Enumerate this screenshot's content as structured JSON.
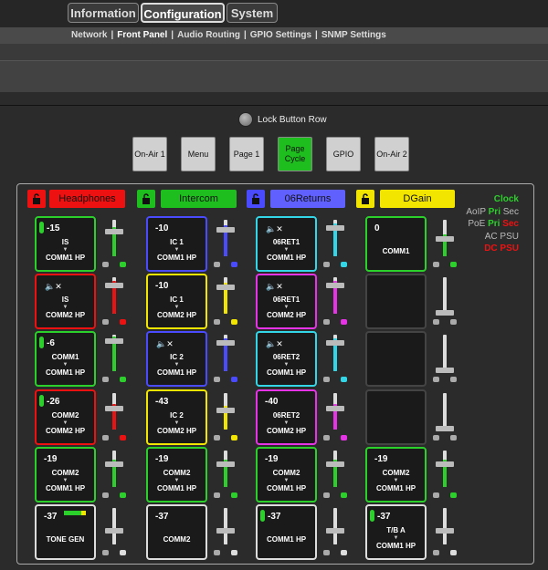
{
  "tabs": [
    {
      "label": "Information",
      "active": false
    },
    {
      "label": "Configuration",
      "active": true
    },
    {
      "label": "System",
      "active": false
    }
  ],
  "subnav": [
    {
      "label": "Network",
      "active": false
    },
    {
      "label": "Front Panel",
      "active": true
    },
    {
      "label": "Audio Routing",
      "active": false
    },
    {
      "label": "GPIO Settings",
      "active": false
    },
    {
      "label": "SNMP Settings",
      "active": false
    }
  ],
  "lock_row_label": "Lock Button Row",
  "page_buttons": [
    {
      "label": "On-Air 1",
      "active": false
    },
    {
      "label": "Menu",
      "active": false
    },
    {
      "label": "Page 1",
      "active": false
    },
    {
      "label": "Page Cycle",
      "active": true
    },
    {
      "label": "GPIO",
      "active": false
    },
    {
      "label": "On-Air 2",
      "active": false
    }
  ],
  "groups": [
    {
      "name": "Headphones",
      "color": "#ee1111",
      "name_color": "#ee1111"
    },
    {
      "name": "Intercom",
      "color": "#1dbe1d",
      "name_color": "#1dbe1d"
    },
    {
      "name": "06Returns",
      "color": "#4a4aff",
      "name_color": "#6060ff"
    },
    {
      "name": "DGain",
      "color": "#f2e600",
      "name_color": "#f2e600"
    }
  ],
  "status": {
    "clock": {
      "label": "Clock",
      "color": "#2bd02b"
    },
    "aoip": {
      "label": "AoIP",
      "pri": "Pri",
      "sec": "Sec",
      "pri_color": "#2bd02b",
      "sec_color": "#bbbbbb"
    },
    "poe": {
      "label": "PoE",
      "pri": "Pri",
      "sec": "Sec",
      "pri_color": "#2bd02b",
      "sec_color": "#ee1111"
    },
    "ac": {
      "label": "AC PSU",
      "color": "#bbbbbb"
    },
    "dc": {
      "label": "DC PSU",
      "color": "#ee1111"
    }
  },
  "columns": [
    [
      {
        "level": "-15",
        "src": "IS",
        "dst": "COMM1 HP",
        "border": "#2bd02b",
        "pill": true,
        "fader": "#2bd02b",
        "fill": 0.8
      },
      {
        "mute": true,
        "src": "IS",
        "dst": "COMM2 HP",
        "border": "#ee1111",
        "fader": "#ee1111",
        "fill": 0.9
      },
      {
        "level": "-6",
        "src": "COMM1",
        "dst": "COMM1 HP",
        "border": "#2bd02b",
        "pill": true,
        "fader": "#2bd02b",
        "fill": 0.95
      },
      {
        "level": "-26",
        "src": "COMM2",
        "dst": "COMM2 HP",
        "border": "#ee1111",
        "pill": true,
        "fader": "#ee1111",
        "fill": 0.7
      },
      {
        "level": "-19",
        "src": "COMM2",
        "dst": "COMM1 HP",
        "border": "#2bd02b",
        "fader": "#2bd02b",
        "fill": 0.75
      },
      {
        "level": "-37",
        "src": "TONE GEN",
        "dst": "",
        "border": "#dddddd",
        "meter": true,
        "fader": "#dddddd",
        "fill": 0.5
      }
    ],
    [
      {
        "level": "-10",
        "src": "IC 1",
        "dst": "COMM1 HP",
        "border": "#4a4aff",
        "fader": "#4a4aff",
        "fill": 0.85
      },
      {
        "level": "-10",
        "src": "IC 1",
        "dst": "COMM2 HP",
        "border": "#f2e600",
        "fader": "#f2e600",
        "fill": 0.85
      },
      {
        "mute": true,
        "src": "IC 2",
        "dst": "COMM1 HP",
        "border": "#4a4aff",
        "fader": "#4a4aff",
        "fill": 0.9
      },
      {
        "level": "-43",
        "src": "IC 2",
        "dst": "COMM2 HP",
        "border": "#f2e600",
        "fader": "#f2e600",
        "fill": 0.65
      },
      {
        "level": "-19",
        "src": "COMM2",
        "dst": "COMM1 HP",
        "border": "#2bd02b",
        "fader": "#2bd02b",
        "fill": 0.75
      },
      {
        "level": "-37",
        "src": "COMM2",
        "dst": "",
        "border": "#dddddd",
        "fader": "#dddddd",
        "fill": 0.5
      }
    ],
    [
      {
        "mute": true,
        "src": "06RET1",
        "dst": "COMM1 HP",
        "border": "#33d6e6",
        "fader": "#33d6e6",
        "fill": 0.9
      },
      {
        "mute": true,
        "src": "06RET1",
        "dst": "COMM2 HP",
        "border": "#e633e6",
        "fader": "#e633e6",
        "fill": 0.9
      },
      {
        "mute": true,
        "src": "06RET2",
        "dst": "COMM1 HP",
        "border": "#33d6e6",
        "fader": "#33d6e6",
        "fill": 0.9
      },
      {
        "level": "-40",
        "src": "06RET2",
        "dst": "COMM2 HP",
        "border": "#e633e6",
        "fader": "#e633e6",
        "fill": 0.7
      },
      {
        "level": "-19",
        "src": "COMM2",
        "dst": "COMM1 HP",
        "border": "#2bd02b",
        "fader": "#2bd02b",
        "fill": 0.75
      },
      {
        "level": "-37",
        "src": "COMM1 HP",
        "dst": "",
        "border": "#dddddd",
        "pill": true,
        "fader": "#dddddd",
        "fill": 0.5
      }
    ],
    [
      {
        "level": "0",
        "src": "COMM1",
        "dst": "",
        "border": "#2bd02b",
        "fader": "#2bd02b",
        "fill": 0.6
      },
      {
        "empty": true,
        "border": "#444444",
        "fader": "#777777",
        "fill": 0.0
      },
      {
        "empty": true,
        "border": "#444444",
        "fader": "#777777",
        "fill": 0.0
      },
      {
        "empty": true,
        "border": "#444444",
        "fader": "#777777",
        "fill": 0.0
      },
      {
        "level": "-19",
        "src": "COMM2",
        "dst": "COMM1 HP",
        "border": "#2bd02b",
        "fader": "#2bd02b",
        "fill": 0.75
      },
      {
        "level": "-37",
        "src": "T/B A",
        "dst": "COMM1 HP",
        "border": "#dddddd",
        "pill": true,
        "fader": "#dddddd",
        "fill": 0.5
      }
    ]
  ]
}
